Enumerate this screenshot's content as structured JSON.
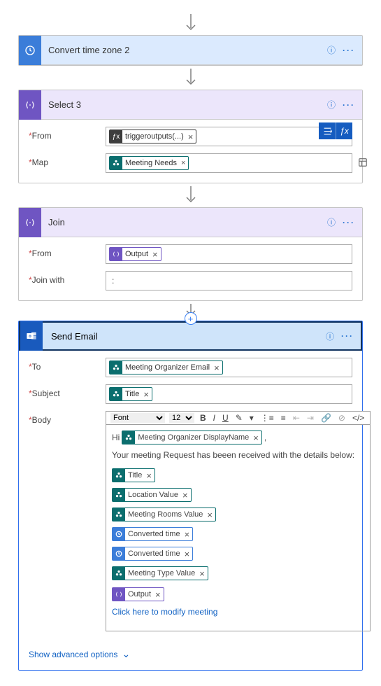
{
  "card_time": {
    "title": "Convert time zone 2"
  },
  "card_select": {
    "title": "Select 3",
    "labels": {
      "from": "From",
      "map": "Map"
    },
    "tokens": {
      "from": "triggeroutputs(...)",
      "map": "Meeting Needs"
    }
  },
  "card_join": {
    "title": "Join",
    "labels": {
      "from": "From",
      "joinwith": "Join with"
    },
    "tokens": {
      "from": "Output"
    },
    "joinwith_value": ":"
  },
  "card_email": {
    "title": "Send Email",
    "labels": {
      "to": "To",
      "subject": "Subject",
      "body": "Body"
    },
    "to_token": "Meeting Organizer Email",
    "subject_token": "Title",
    "toolbar": {
      "font": "Font",
      "size": "12"
    },
    "body": {
      "hi": "Hi",
      "organizer_token": "Meeting Organizer DisplayName",
      "intro": "Your meeting Request has beeen received with the details below:",
      "tokens": {
        "title": "Title",
        "location": "Location Value",
        "rooms": "Meeting Rooms Value",
        "time1": "Converted time",
        "time2": "Converted time",
        "type": "Meeting Type Value",
        "output": "Output"
      },
      "link": "Click here to modify meeting"
    },
    "advanced": "Show advanced options"
  }
}
